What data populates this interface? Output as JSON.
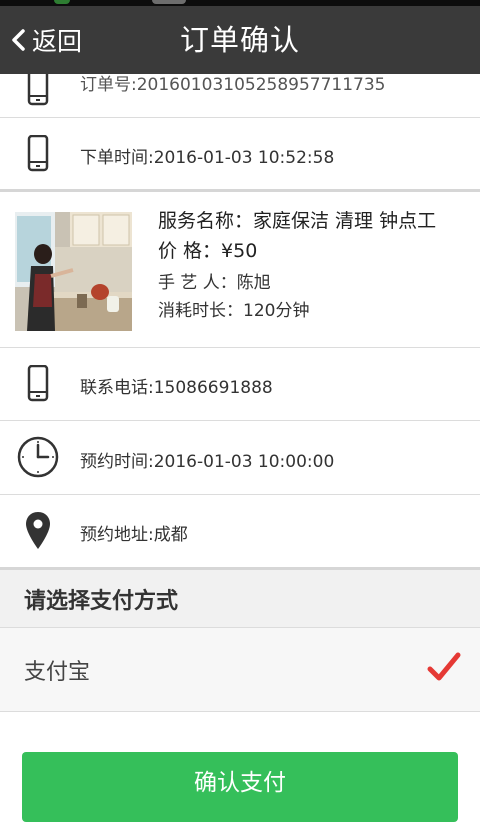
{
  "header": {
    "back_label": "返回",
    "title": "订单确认"
  },
  "order": {
    "order_number": "订单号:20160103105258957711735",
    "order_time": "下单时间:2016-01-03 10:52:58"
  },
  "service": {
    "name": "服务名称：家庭保洁 清理 钟点工",
    "price": "价 格：¥50",
    "worker": "手 艺 人：陈旭",
    "duration": "消耗时长：120分钟"
  },
  "contact": {
    "phone": "联系电话:15086691888",
    "appointment_time": "预约时间:2016-01-03 10:00:00",
    "address": "预约地址:成都"
  },
  "payment": {
    "section_title": "请选择支付方式",
    "option_label": "支付宝",
    "option_selected": true
  },
  "confirm_label": "确认支付",
  "colors": {
    "navbar": "#3a3a3a",
    "confirm_button": "#35bf5a",
    "check": "#e53935"
  },
  "icons": [
    "back-chevron-icon",
    "phone-icon",
    "clock-icon",
    "location-pin-icon",
    "checkmark-icon"
  ]
}
